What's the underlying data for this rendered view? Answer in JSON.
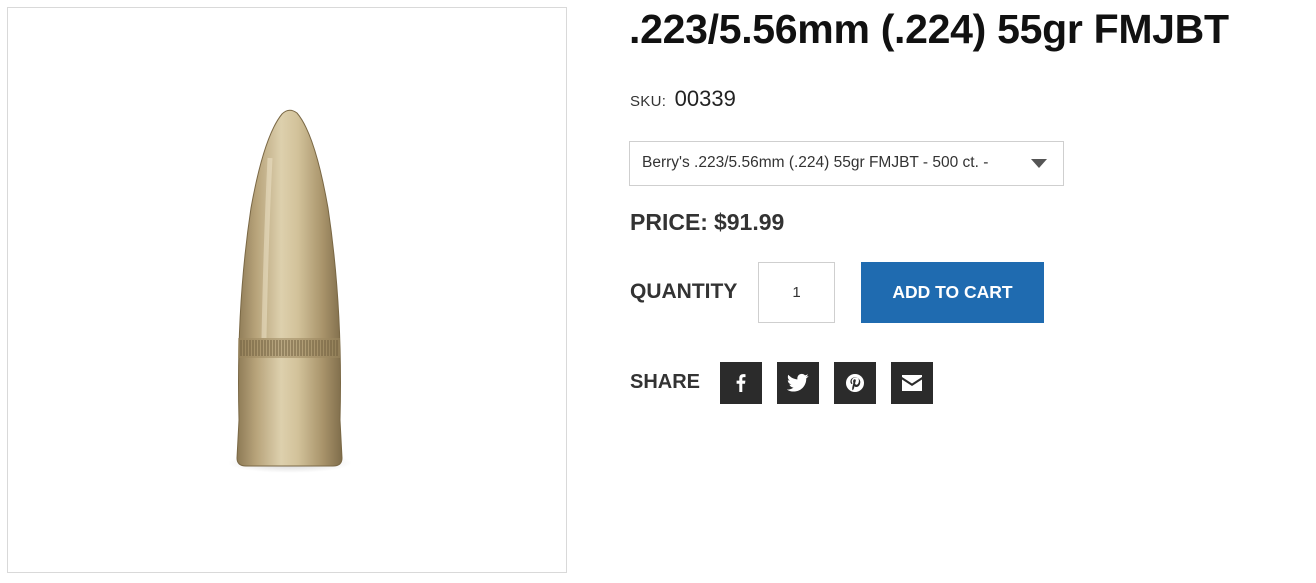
{
  "product": {
    "title": ".223/5.56mm (.224) 55gr FMJBT",
    "sku_label": "SKU:",
    "sku_value": "00339",
    "image_alt": "55gr FMJBT bullet"
  },
  "variant": {
    "selected": "Berry's .223/5.56mm (.224) 55gr FMJBT - 500 ct. -"
  },
  "price": {
    "label": "PRICE:",
    "value": "$91.99"
  },
  "quantity": {
    "label": "QUANTITY",
    "value": "1"
  },
  "cart": {
    "add_label": "ADD TO CART"
  },
  "share": {
    "label": "SHARE",
    "buttons": [
      {
        "icon": "facebook-icon"
      },
      {
        "icon": "twitter-icon"
      },
      {
        "icon": "pinterest-icon"
      },
      {
        "icon": "email-icon"
      }
    ]
  },
  "colors": {
    "accent": "#1f6bb0",
    "share_button_bg": "#2b2b2b",
    "border": "#cfcfcf"
  }
}
